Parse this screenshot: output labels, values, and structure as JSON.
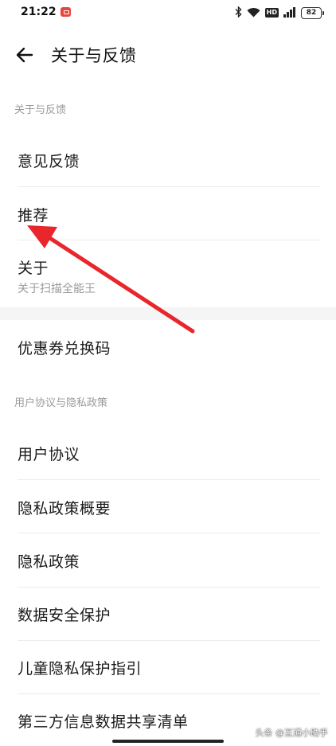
{
  "status_bar": {
    "time": "21:22",
    "icons": [
      "notification-app-icon",
      "bluetooth-icon",
      "wifi-icon",
      "hd-icon",
      "signal-icon"
    ],
    "hd_label": "HD",
    "battery": "82"
  },
  "header": {
    "back_icon": "arrow-left-icon",
    "title": "关于与反馈"
  },
  "sections": [
    {
      "title": "关于与反馈",
      "items": [
        {
          "label": "意见反馈"
        },
        {
          "label": "推荐"
        },
        {
          "label": "关于",
          "sublabel": "关于扫描全能王"
        }
      ]
    },
    {
      "title": "",
      "items": [
        {
          "label": "优惠券兑换码"
        }
      ]
    },
    {
      "title": "用户协议与隐私政策",
      "items": [
        {
          "label": "用户协议"
        },
        {
          "label": "隐私政策概要"
        },
        {
          "label": "隐私政策"
        },
        {
          "label": "数据安全保护"
        },
        {
          "label": "儿童隐私保护指引"
        },
        {
          "label": "第三方信息数据共享清单"
        }
      ]
    }
  ],
  "annotation": {
    "arrow_color": "#e8262b"
  },
  "watermark": "头条 @互通小助手"
}
